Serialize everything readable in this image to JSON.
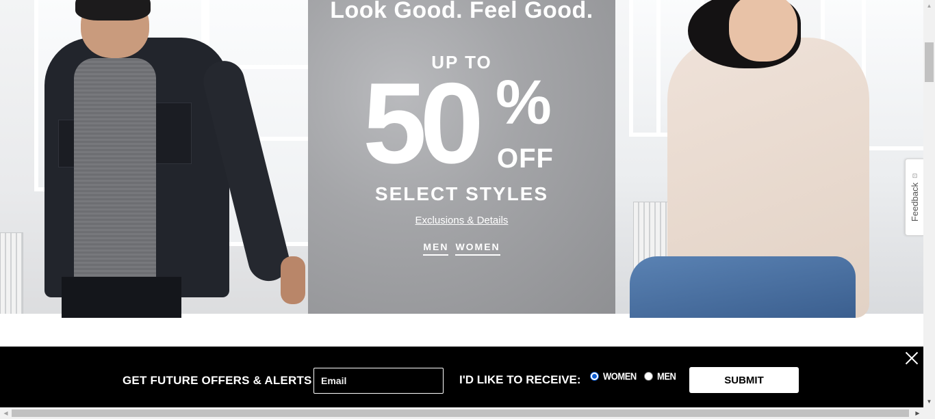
{
  "hero": {
    "headline": "Look Good. Feel Good.",
    "up_to": "UP TO",
    "discount_number": "50",
    "discount_percent": "%",
    "discount_off": "OFF",
    "select_styles": "SELECT STYLES",
    "details_link": "Exclusions & Details",
    "links": {
      "men": "MEN",
      "women": "WOMEN"
    }
  },
  "feedback": {
    "label": "Feedback",
    "icon": "feedback-icon"
  },
  "signup": {
    "title": "GET FUTURE OFFERS & ALERTS",
    "email_placeholder": "Email",
    "email_value": "",
    "receive_label": "I'D LIKE TO RECEIVE:",
    "options": [
      {
        "label": "WOMEN",
        "checked": true
      },
      {
        "label": "MEN",
        "checked": false
      }
    ],
    "submit_label": "SUBMIT",
    "close_icon": "close-icon"
  },
  "colors": {
    "signup_background": "#000000",
    "radio_accent": "#0a5bd3",
    "promo_background": "#a4a5a8"
  }
}
